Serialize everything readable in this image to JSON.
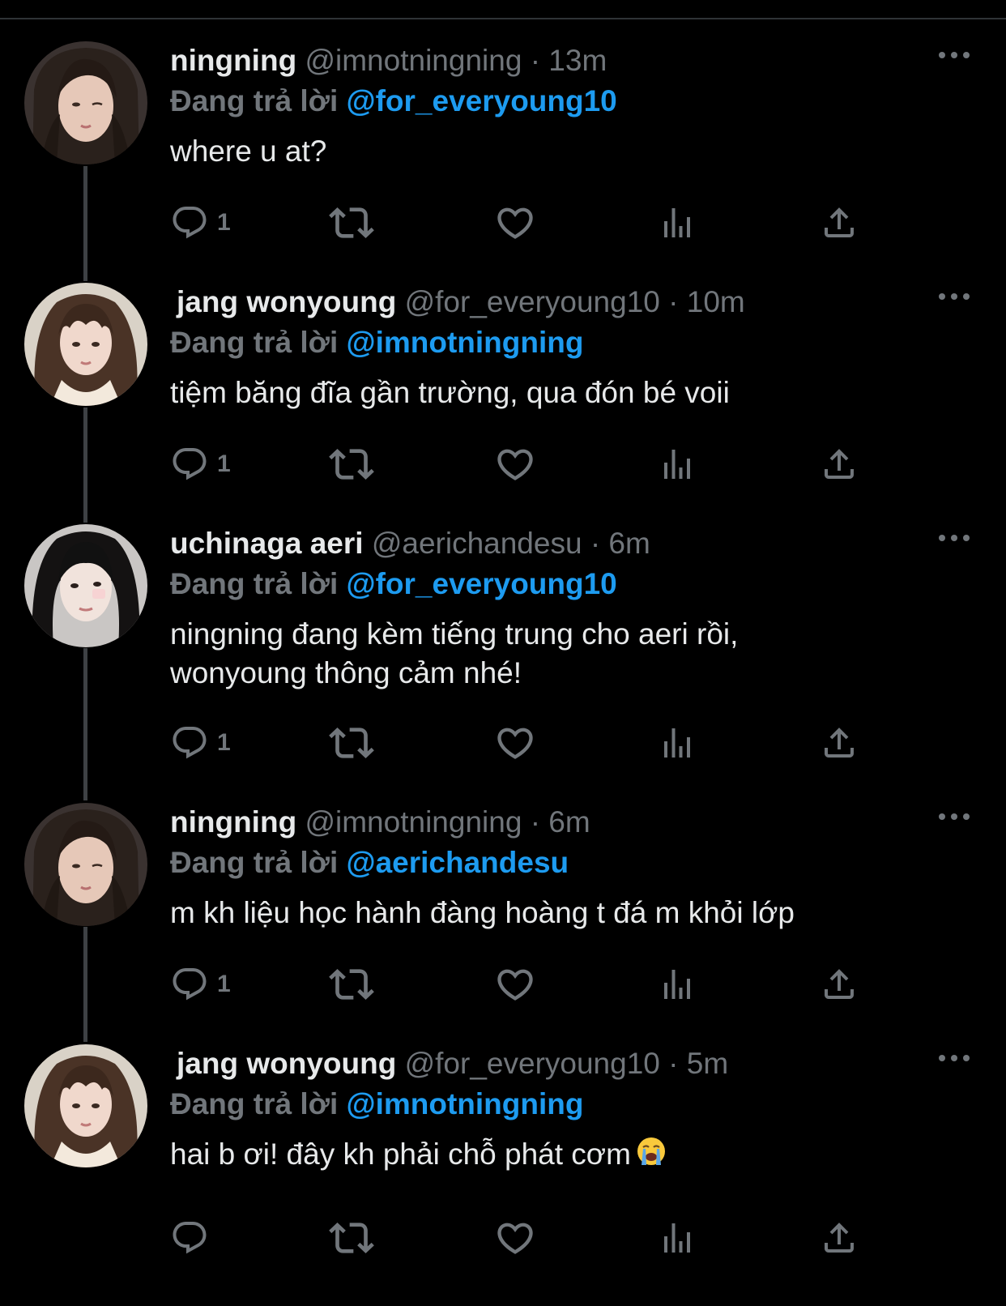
{
  "colors": {
    "background": "#000000",
    "primary_text": "#e7e9ea",
    "secondary_text": "#71767b",
    "accent": "#1d9bf0",
    "thread_line": "#3e4144"
  },
  "icons": {
    "more": "more-horizontal-icon",
    "reply": "speech-bubble-icon",
    "retweet": "retweet-arrows-icon",
    "like": "heart-icon",
    "views": "bar-chart-icon",
    "share": "share-upload-icon"
  },
  "tweets": [
    {
      "name": "ningning",
      "handle": "@imnotningning",
      "time": "· 13m",
      "reply_prefix": "Đang trả lời ",
      "reply_to": "@for_everyoung10",
      "text": "where u at?",
      "reply_count": "1"
    },
    {
      "name": "jang wonyoung",
      "handle": "@for_everyoung10",
      "time": "· 10m",
      "reply_prefix": "Đang trả lời ",
      "reply_to": "@imnotningning",
      "text": "tiệm băng đĩa gần trường, qua đón bé voii",
      "reply_count": "1"
    },
    {
      "name": "uchinaga aeri",
      "handle": "@aerichandesu",
      "time": "· 6m",
      "reply_prefix": "Đang trả lời ",
      "reply_to": "@for_everyoung10",
      "text_line1": "ningning đang kèm tiếng trung cho aeri rồi,",
      "text_line2": "wonyoung thông cảm nhé!",
      "reply_count": "1"
    },
    {
      "name": "ningning",
      "handle": "@imnotningning",
      "time": "· 6m",
      "reply_prefix": "Đang trả lời ",
      "reply_to": "@aerichandesu",
      "text": "m kh liệu học hành đàng hoàng t đá m khỏi lớp",
      "reply_count": "1"
    },
    {
      "name": "jang wonyoung",
      "handle": "@for_everyoung10",
      "time": "· 5m",
      "reply_prefix": "Đang trả lời ",
      "reply_to": "@imnotningning",
      "text": "hai b ơi! đây kh phải chỗ phát cơm",
      "emoji": "loudly-crying-face-emoji",
      "reply_count": ""
    }
  ]
}
